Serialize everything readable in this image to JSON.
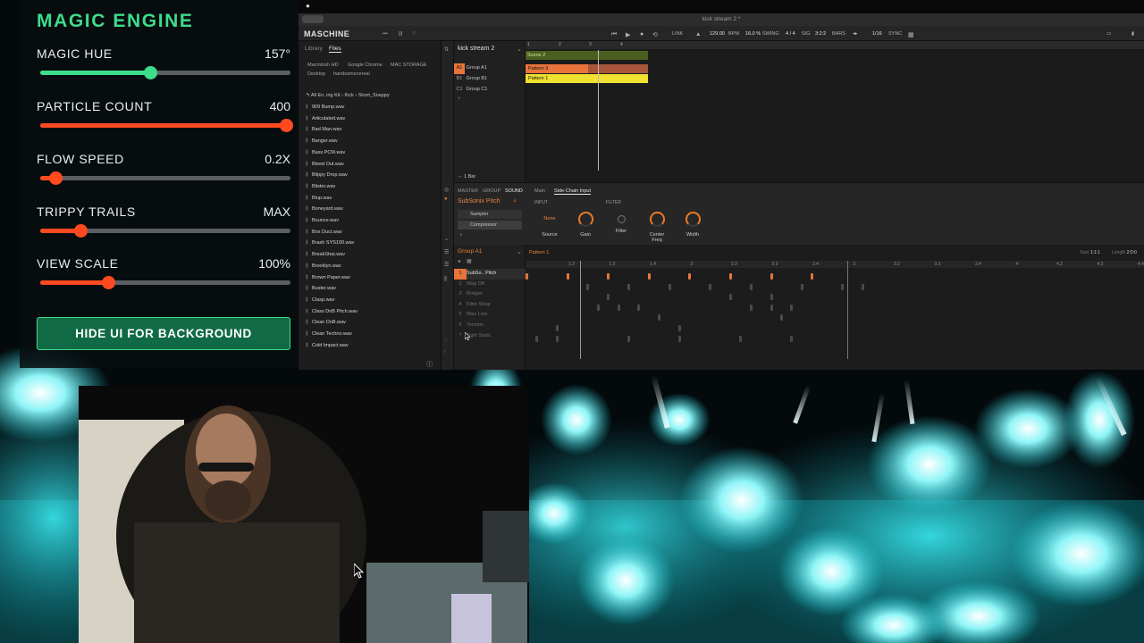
{
  "magic_panel": {
    "title": "MAGIC ENGINE",
    "controls": [
      {
        "label": "MAGIC HUE",
        "value": "157°",
        "level": 0.44,
        "color": "#3ddc8a"
      },
      {
        "label": "PARTICLE COUNT",
        "value": "400",
        "level": 1.0,
        "color": "#ff4a1f"
      },
      {
        "label": "FLOW SPEED",
        "value": "0.2X",
        "level": 0.06,
        "color": "#ff4a1f"
      },
      {
        "label": "TRIPPY TRAILS",
        "value": "MAX",
        "level": 0.16,
        "color": "#ff4a1f"
      },
      {
        "label": "VIEW SCALE",
        "value": "100%",
        "level": 0.27,
        "color": "#ff4a1f"
      }
    ],
    "hide_button": "HIDE UI FOR BACKGROUND"
  },
  "maschine": {
    "window_title": "kick stream 2 *",
    "logo": "MASCHINE",
    "toolbar": {
      "link": "LINK",
      "bpm_value": "129.00",
      "bpm_label": "BPM",
      "swing_value": "16.0 %",
      "swing_label": "SWING",
      "sig": "4 / 4",
      "sig_label": "SIG",
      "bars": "3:2:2",
      "bars_label": "BARS",
      "grid": "1/16",
      "sync": "SYNC"
    },
    "browser": {
      "tabs": [
        "Library",
        "Files"
      ],
      "locations": [
        "Macintosh HD",
        "Google Chrome",
        "MAC STORAGE",
        "Desktop",
        "handsomecereal"
      ],
      "breadcrumb": [
        "All En..ing Kit",
        "Kick",
        "Short_Snappy"
      ],
      "files": [
        "909 Bump.wav",
        "Articulated.wav",
        "Bad Man.wav",
        "Banger.wav",
        "Bass PCM.wav",
        "Bleed Out.wav",
        "Blippy Drop.wav",
        "Blister.wav",
        "Blup.wav",
        "Boneyard.wav",
        "Bounce.wav",
        "Box Duct.wav",
        "Brash SYS100.wav",
        "BreakStep.wav",
        "Brooklyn.wav",
        "Brown Paper.wav",
        "Buster.wav",
        "Clasp.wav",
        "Class DnB Pitch.wav",
        "Clean DnB.wav",
        "Clean Techno.wav",
        "Cold Impact.wav"
      ]
    },
    "arranger": {
      "project": "kick stream 2",
      "groups": [
        {
          "tag": "A1",
          "name": "Group A1",
          "color": "#e8743b"
        },
        {
          "tag": "B1",
          "name": "Group B1",
          "color": "#8a8a8a"
        },
        {
          "tag": "C1",
          "name": "Group C1",
          "color": "#8a8a8a"
        }
      ],
      "ruler": [
        "1",
        "2",
        "3",
        "4"
      ],
      "scene": "Scene 2",
      "patterns": [
        {
          "name": "Pattern 3",
          "color": "#e8743b"
        },
        {
          "name": "Pattern 1",
          "color": "#f0e130"
        }
      ],
      "length_label": "1 Bar"
    },
    "plugin": {
      "tabs": [
        "MASTER",
        "GROUP",
        "SOUND"
      ],
      "page_tabs": [
        "Main",
        "Side-Chain Input"
      ],
      "sections": [
        "INPUT",
        "FILTER"
      ],
      "sound_name": "SubSonix Pitch",
      "slots": [
        "Sampler",
        "Compressor"
      ],
      "knobs": [
        {
          "label": "Source",
          "value": "None"
        },
        {
          "label": "Gain"
        },
        {
          "label": "Filter"
        },
        {
          "label": "Center Freq"
        },
        {
          "label": "Width"
        }
      ]
    },
    "pattern_editor": {
      "group": "Group A1",
      "pattern": "Pattern 1",
      "start_label": "Start",
      "start_value": "1:1:1",
      "length_label": "Length",
      "length_value": "2:0:0",
      "ruler": [
        "1.2",
        "1.3",
        "1.4",
        "2",
        "2.2",
        "2.3",
        "2.4",
        "3",
        "3.2",
        "3.3",
        "3.4",
        "4",
        "4.2",
        "4.3",
        "4.4"
      ],
      "sounds": [
        "SubSo.. Pitch",
        "Wag Off",
        "Bridget",
        "Filter Wrap",
        "Misc Low",
        "Tension",
        "Tight Static"
      ]
    }
  }
}
